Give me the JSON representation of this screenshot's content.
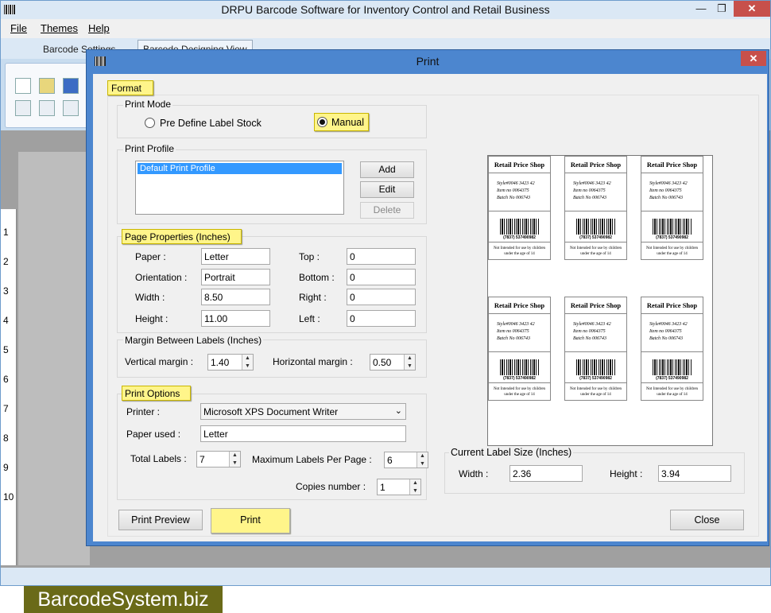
{
  "window": {
    "title": "DRPU Barcode Software for Inventory Control and Retail Business",
    "minimize": "—",
    "maximize": "❐",
    "close": "✕"
  },
  "menu": {
    "file": "File",
    "themes": "Themes",
    "help": "Help"
  },
  "tabs": {
    "settings": "Barcode Settings",
    "designing": "Barcode Designing View"
  },
  "ruler": [
    "1",
    "2",
    "3",
    "4",
    "5",
    "6",
    "7",
    "8",
    "9",
    "10"
  ],
  "dialog": {
    "title": "Print",
    "close": "✕",
    "format_label": "Format",
    "print_mode": {
      "title": "Print Mode",
      "predefine": "Pre Define Label Stock",
      "manual": "Manual",
      "selected": "manual"
    },
    "print_profile": {
      "title": "Print Profile",
      "items": [
        "Default Print Profile"
      ],
      "add": "Add",
      "edit": "Edit",
      "delete": "Delete"
    },
    "page_properties": {
      "title": "Page Properties (Inches)",
      "paper_label": "Paper :",
      "paper": "Letter",
      "orientation_label": "Orientation :",
      "orientation": "Portrait",
      "width_label": "Width :",
      "width": "8.50",
      "height_label": "Height :",
      "height": "11.00",
      "top_label": "Top :",
      "top": "0",
      "bottom_label": "Bottom :",
      "bottom": "0",
      "right_label": "Right :",
      "right": "0",
      "left_label": "Left :",
      "left": "0"
    },
    "margin": {
      "title": "Margin Between Labels (Inches)",
      "vertical_label": "Vertical margin :",
      "vertical": "1.40",
      "horizontal_label": "Horizontal margin :",
      "horizontal": "0.50"
    },
    "print_options": {
      "title": "Print Options",
      "printer_label": "Printer :",
      "printer": "Microsoft XPS Document Writer",
      "paper_used_label": "Paper used :",
      "paper_used": "Letter",
      "total_labels_label": "Total Labels :",
      "total_labels": "7",
      "max_per_page_label": "Maximum Labels Per Page :",
      "max_per_page": "6",
      "copies_label": "Copies number :",
      "copies": "1"
    },
    "label_size": {
      "title": "Current Label Size (Inches)",
      "width_label": "Width :",
      "width": "2.36",
      "height_label": "Height :",
      "height": "3.94"
    },
    "buttons": {
      "preview": "Print Preview",
      "print": "Print",
      "close": "Close"
    },
    "sample_label": {
      "header": "Retail Price Shop",
      "line1": "Style#0046 3423 42",
      "line2": "Item no 0064375",
      "line3": "Batch No 006743",
      "barcode_number": "(7837) 537490982",
      "note": "Not Intended for use by children under the age of 14"
    }
  },
  "brand": "BarcodeSystem.biz"
}
